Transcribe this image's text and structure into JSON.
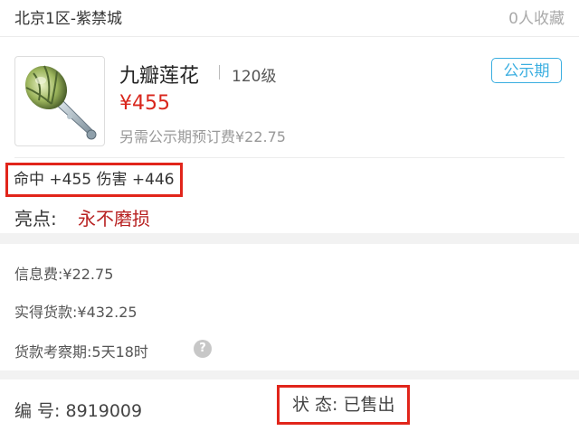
{
  "header": {
    "server": "北京1区-紫禁城",
    "favorites": "0人收藏"
  },
  "item": {
    "name": "九瓣莲花",
    "level": "120级",
    "badge": "公示期",
    "price": "¥455",
    "reserve_note": "另需公示期预订费¥22.75",
    "stats": "命中 +455 伤害 +446",
    "highlight_label": "亮点:",
    "highlight_value": "永不磨损",
    "image_icon": "lotus-flower-weapon-icon"
  },
  "fees": {
    "info_fee": "信息费:¥22.75",
    "actual_payment": "实得货款:¥432.25",
    "review_period": "货款考察期:5天18时",
    "help_glyph": "?"
  },
  "footer": {
    "serial": "编  号: 8919009",
    "status": "状  态: 已售出"
  },
  "colors": {
    "price_red": "#d9261c",
    "badge_blue": "#3aaee0",
    "highlight_red": "#b82222",
    "annotation_box_red": "#e1251b"
  }
}
